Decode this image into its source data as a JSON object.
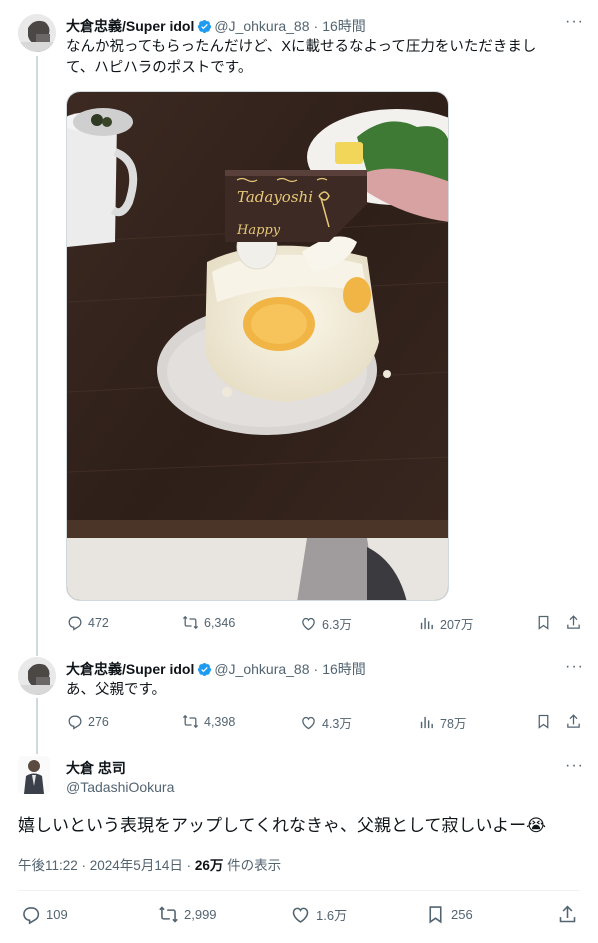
{
  "tweet1": {
    "name": "大倉忠義/Super idol",
    "handle": "@J_ohkura_88",
    "time": "16時間",
    "text_line1": "なんか祝ってもらったんだけど、Xに載せるなよって圧力をいただきまし",
    "text_line2": "て、ハピハラのポストです。",
    "photo_card_text": "Tadayoshi",
    "photo_card_text2": "Happy",
    "stats": {
      "replies": "472",
      "reposts": "6,346",
      "likes": "6.3万",
      "views": "207万"
    }
  },
  "tweet2": {
    "name": "大倉忠義/Super idol",
    "handle": "@J_ohkura_88",
    "time": "16時間",
    "text": "あ、父親です。",
    "stats": {
      "replies": "276",
      "reposts": "4,398",
      "likes": "4.3万",
      "views": "78万"
    }
  },
  "tweet3": {
    "name": "大倉 忠司",
    "handle": "@TadashiOokura",
    "text": "嬉しいという表現をアップしてくれなきゃ、父親として寂しいよー😭",
    "meta_time": "午後11:22 · 2024年5月14日 · ",
    "meta_views": "26万",
    "meta_views_label": " 件の表示",
    "stats": {
      "replies": "109",
      "reposts": "2,999",
      "likes": "1.6万",
      "bookmarks": "256"
    }
  },
  "colors": {
    "text": "#0f1419",
    "secondary": "#536471",
    "verified": "#1d9bf0",
    "line": "#cfd9de"
  }
}
